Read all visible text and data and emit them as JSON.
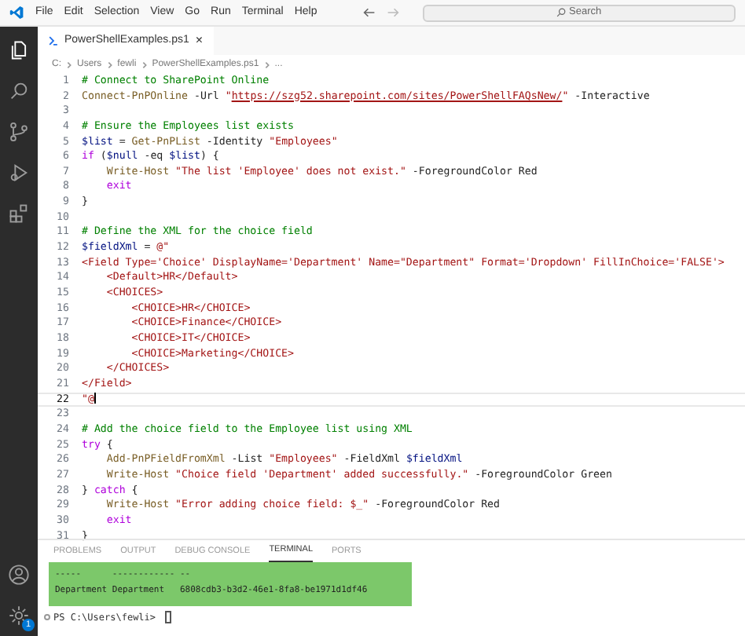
{
  "menu": [
    "File",
    "Edit",
    "Selection",
    "View",
    "Go",
    "Run",
    "Terminal",
    "Help"
  ],
  "search": {
    "placeholder": "Search"
  },
  "activity": [
    {
      "kind": "files",
      "selected": true
    },
    {
      "kind": "search",
      "selected": false
    },
    {
      "kind": "scm",
      "selected": false
    },
    {
      "kind": "debug",
      "selected": false
    },
    {
      "kind": "extensions",
      "selected": false
    }
  ],
  "settings_badge": "1",
  "tabs": [
    {
      "label": "PowerShellExamples.ps1",
      "close": "×",
      "selected": true
    }
  ],
  "breadcrumb": [
    "C:",
    "Users",
    "fewli",
    "PowerShellExamples.ps1",
    "..."
  ],
  "lines": [
    {
      "number": "1",
      "current": false,
      "tokens": [
        {
          "text": "# Connect to SharePoint Online",
          "kind": "comment"
        }
      ]
    },
    {
      "number": "2",
      "current": false,
      "tokens": [
        {
          "text": "Connect-PnPOnline",
          "kind": "cmdlet"
        },
        {
          "text": " -Url ",
          "kind": "plain"
        },
        {
          "text": "\"",
          "kind": "string"
        },
        {
          "text": "https://szg52.sharepoint.com/sites/PowerShellFAQsNew/",
          "kind": "link"
        },
        {
          "text": "\"",
          "kind": "string"
        },
        {
          "text": " -Interactive",
          "kind": "plain"
        }
      ]
    },
    {
      "number": "3",
      "current": false
    },
    {
      "number": "4",
      "current": false,
      "tokens": [
        {
          "text": "# Ensure the Employees list exists",
          "kind": "comment"
        }
      ]
    },
    {
      "number": "5",
      "current": false,
      "tokens": [
        {
          "text": "$list",
          "kind": "variable"
        },
        {
          "text": " = ",
          "kind": "plain"
        },
        {
          "text": "Get-PnPList",
          "kind": "cmdlet"
        },
        {
          "text": " -Identity ",
          "kind": "plain"
        },
        {
          "text": "\"Employees\"",
          "kind": "string"
        }
      ]
    },
    {
      "number": "6",
      "current": false,
      "tokens": [
        {
          "text": "if",
          "kind": "keyword"
        },
        {
          "text": " (",
          "kind": "plain"
        },
        {
          "text": "$null",
          "kind": "variable"
        },
        {
          "text": " -eq ",
          "kind": "plain"
        },
        {
          "text": "$list",
          "kind": "variable"
        },
        {
          "text": ") {",
          "kind": "plain"
        }
      ]
    },
    {
      "number": "7",
      "current": false,
      "tokens": [
        {
          "text": "    Write-Host",
          "kind": "cmdlet"
        },
        {
          "text": " \"The list 'Employee' does not exist.\"",
          "kind": "string"
        },
        {
          "text": " -ForegroundColor Red",
          "kind": "plain"
        }
      ]
    },
    {
      "number": "8",
      "current": false,
      "tokens": [
        {
          "text": "    exit",
          "kind": "keyword"
        }
      ]
    },
    {
      "number": "9",
      "current": false,
      "tokens": [
        {
          "text": "}",
          "kind": "plain"
        }
      ]
    },
    {
      "number": "10",
      "current": false
    },
    {
      "number": "11",
      "current": false,
      "tokens": [
        {
          "text": "# Define the XML for the choice field",
          "kind": "comment"
        }
      ]
    },
    {
      "number": "12",
      "current": false,
      "tokens": [
        {
          "text": "$fieldXml",
          "kind": "variable"
        },
        {
          "text": " = ",
          "kind": "plain"
        },
        {
          "text": "@\"",
          "kind": "string"
        }
      ]
    },
    {
      "number": "13",
      "current": false,
      "tokens": [
        {
          "text": "<Field Type='Choice' DisplayName='Department' Name=\"Department\" Format='Dropdown' FillInChoice='FALSE'>",
          "kind": "string"
        }
      ]
    },
    {
      "number": "14",
      "current": false,
      "tokens": [
        {
          "text": "    <Default>HR</Default>",
          "kind": "string"
        }
      ]
    },
    {
      "number": "15",
      "current": false,
      "tokens": [
        {
          "text": "    <CHOICES>",
          "kind": "string"
        }
      ]
    },
    {
      "number": "16",
      "current": false,
      "tokens": [
        {
          "text": "        <CHOICE>HR</CHOICE>",
          "kind": "string"
        }
      ]
    },
    {
      "number": "17",
      "current": false,
      "tokens": [
        {
          "text": "        <CHOICE>Finance</CHOICE>",
          "kind": "string"
        }
      ]
    },
    {
      "number": "18",
      "current": false,
      "tokens": [
        {
          "text": "        <CHOICE>IT</CHOICE>",
          "kind": "string"
        }
      ]
    },
    {
      "number": "19",
      "current": false,
      "tokens": [
        {
          "text": "        <CHOICE>Marketing</CHOICE>",
          "kind": "string"
        }
      ]
    },
    {
      "number": "20",
      "current": false,
      "tokens": [
        {
          "text": "    </CHOICES>",
          "kind": "string"
        }
      ]
    },
    {
      "number": "21",
      "current": false,
      "tokens": [
        {
          "text": "</Field>",
          "kind": "string"
        }
      ]
    },
    {
      "number": "22",
      "current": true,
      "tokens": [
        {
          "text": "\"@",
          "kind": "string"
        }
      ]
    },
    {
      "number": "23",
      "current": false
    },
    {
      "number": "24",
      "current": false,
      "tokens": [
        {
          "text": "# Add the choice field to the Employee list using XML",
          "kind": "comment"
        }
      ]
    },
    {
      "number": "25",
      "current": false,
      "tokens": [
        {
          "text": "try",
          "kind": "keyword"
        },
        {
          "text": " {",
          "kind": "plain"
        }
      ]
    },
    {
      "number": "26",
      "current": false,
      "tokens": [
        {
          "text": "    Add-PnPFieldFromXml",
          "kind": "cmdlet"
        },
        {
          "text": " -List ",
          "kind": "plain"
        },
        {
          "text": "\"Employees\"",
          "kind": "string"
        },
        {
          "text": " -FieldXml ",
          "kind": "plain"
        },
        {
          "text": "$fieldXml",
          "kind": "variable"
        }
      ]
    },
    {
      "number": "27",
      "current": false,
      "tokens": [
        {
          "text": "    Write-Host",
          "kind": "cmdlet"
        },
        {
          "text": " \"Choice field 'Department' added successfully.\"",
          "kind": "string"
        },
        {
          "text": " -ForegroundColor Green",
          "kind": "plain"
        }
      ]
    },
    {
      "number": "28",
      "current": false,
      "tokens": [
        {
          "text": "} ",
          "kind": "plain"
        },
        {
          "text": "catch",
          "kind": "keyword"
        },
        {
          "text": " {",
          "kind": "plain"
        }
      ]
    },
    {
      "number": "29",
      "current": false,
      "tokens": [
        {
          "text": "    Write-Host",
          "kind": "cmdlet"
        },
        {
          "text": " \"Error adding choice field: $_\"",
          "kind": "string"
        },
        {
          "text": " -ForegroundColor Red",
          "kind": "plain"
        }
      ]
    },
    {
      "number": "30",
      "current": false,
      "tokens": [
        {
          "text": "    exit",
          "kind": "keyword"
        }
      ]
    },
    {
      "number": "31",
      "current": false,
      "tokens": [
        {
          "text": "}",
          "kind": "plain"
        }
      ]
    }
  ],
  "panel_tabs": [
    {
      "label": "PROBLEMS",
      "selected": false
    },
    {
      "label": "OUTPUT",
      "selected": false
    },
    {
      "label": "DEBUG CONSOLE",
      "selected": false
    },
    {
      "label": "TERMINAL",
      "selected": true
    },
    {
      "label": "PORTS",
      "selected": false
    }
  ],
  "terminal_output": [
    "-----      ------------ --",
    "Department Department   6808cdb3-b3d2-46e1-8fa8-be1971d1df46"
  ],
  "prompt": "PS C:\\Users\\fewli> "
}
